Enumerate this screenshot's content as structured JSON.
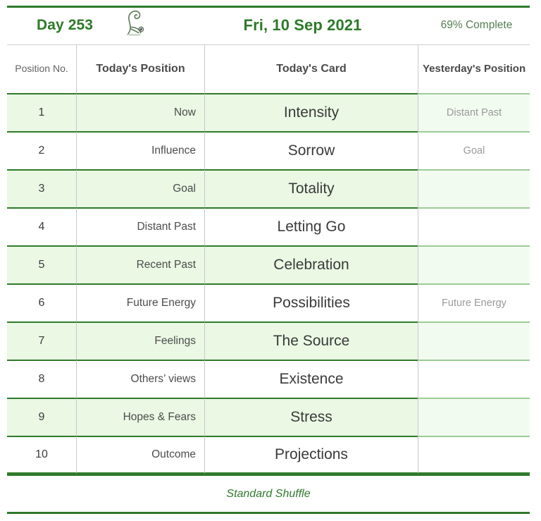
{
  "header": {
    "day_label": "Day 253",
    "date_label": "Fri, 10 Sep 2021",
    "progress_label": "69% Complete",
    "logo_icon": "seated-figure-sketch-icon",
    "accent_color": "#2f7a2c",
    "day_text_color": "#2d7a28",
    "progress_text_color": "#547e51"
  },
  "table": {
    "columns": [
      {
        "key": "position_no",
        "label": "Position No."
      },
      {
        "key": "todays_position",
        "label": "Today's Position"
      },
      {
        "key": "todays_card",
        "label": "Today's Card"
      },
      {
        "key": "yesterdays_position",
        "label": "Yesterday's Position"
      }
    ],
    "column_header_lines": {
      "position_no": [
        "Position",
        "No."
      ],
      "todays_position": [
        "Today's Position"
      ],
      "todays_card": [
        "Today's Card"
      ],
      "yesterdays_position": [
        "Yesterday's",
        "Position"
      ]
    },
    "row_highlight_color": "#eaf8e4",
    "row_highlight_color_last_column": "#f2fbf0",
    "rows": [
      {
        "position_no": "1",
        "todays_position": "Now",
        "todays_card": "Intensity",
        "yesterdays_position": "Distant Past"
      },
      {
        "position_no": "2",
        "todays_position": "Influence",
        "todays_card": "Sorrow",
        "yesterdays_position": "Goal"
      },
      {
        "position_no": "3",
        "todays_position": "Goal",
        "todays_card": "Totality",
        "yesterdays_position": ""
      },
      {
        "position_no": "4",
        "todays_position": "Distant Past",
        "todays_card": "Letting Go",
        "yesterdays_position": ""
      },
      {
        "position_no": "5",
        "todays_position": "Recent Past",
        "todays_card": "Celebration",
        "yesterdays_position": ""
      },
      {
        "position_no": "6",
        "todays_position": "Future Energy",
        "todays_card": "Possibilities",
        "yesterdays_position": "Future Energy"
      },
      {
        "position_no": "7",
        "todays_position": "Feelings",
        "todays_card": "The Source",
        "yesterdays_position": ""
      },
      {
        "position_no": "8",
        "todays_position": "Others’ views",
        "todays_card": "Existence",
        "yesterdays_position": ""
      },
      {
        "position_no": "9",
        "todays_position": "Hopes & Fears",
        "todays_card": "Stress",
        "yesterdays_position": ""
      },
      {
        "position_no": "10",
        "todays_position": "Outcome",
        "todays_card": "Projections",
        "yesterdays_position": ""
      }
    ]
  },
  "footer": {
    "shuffle_label": "Standard Shuffle"
  }
}
